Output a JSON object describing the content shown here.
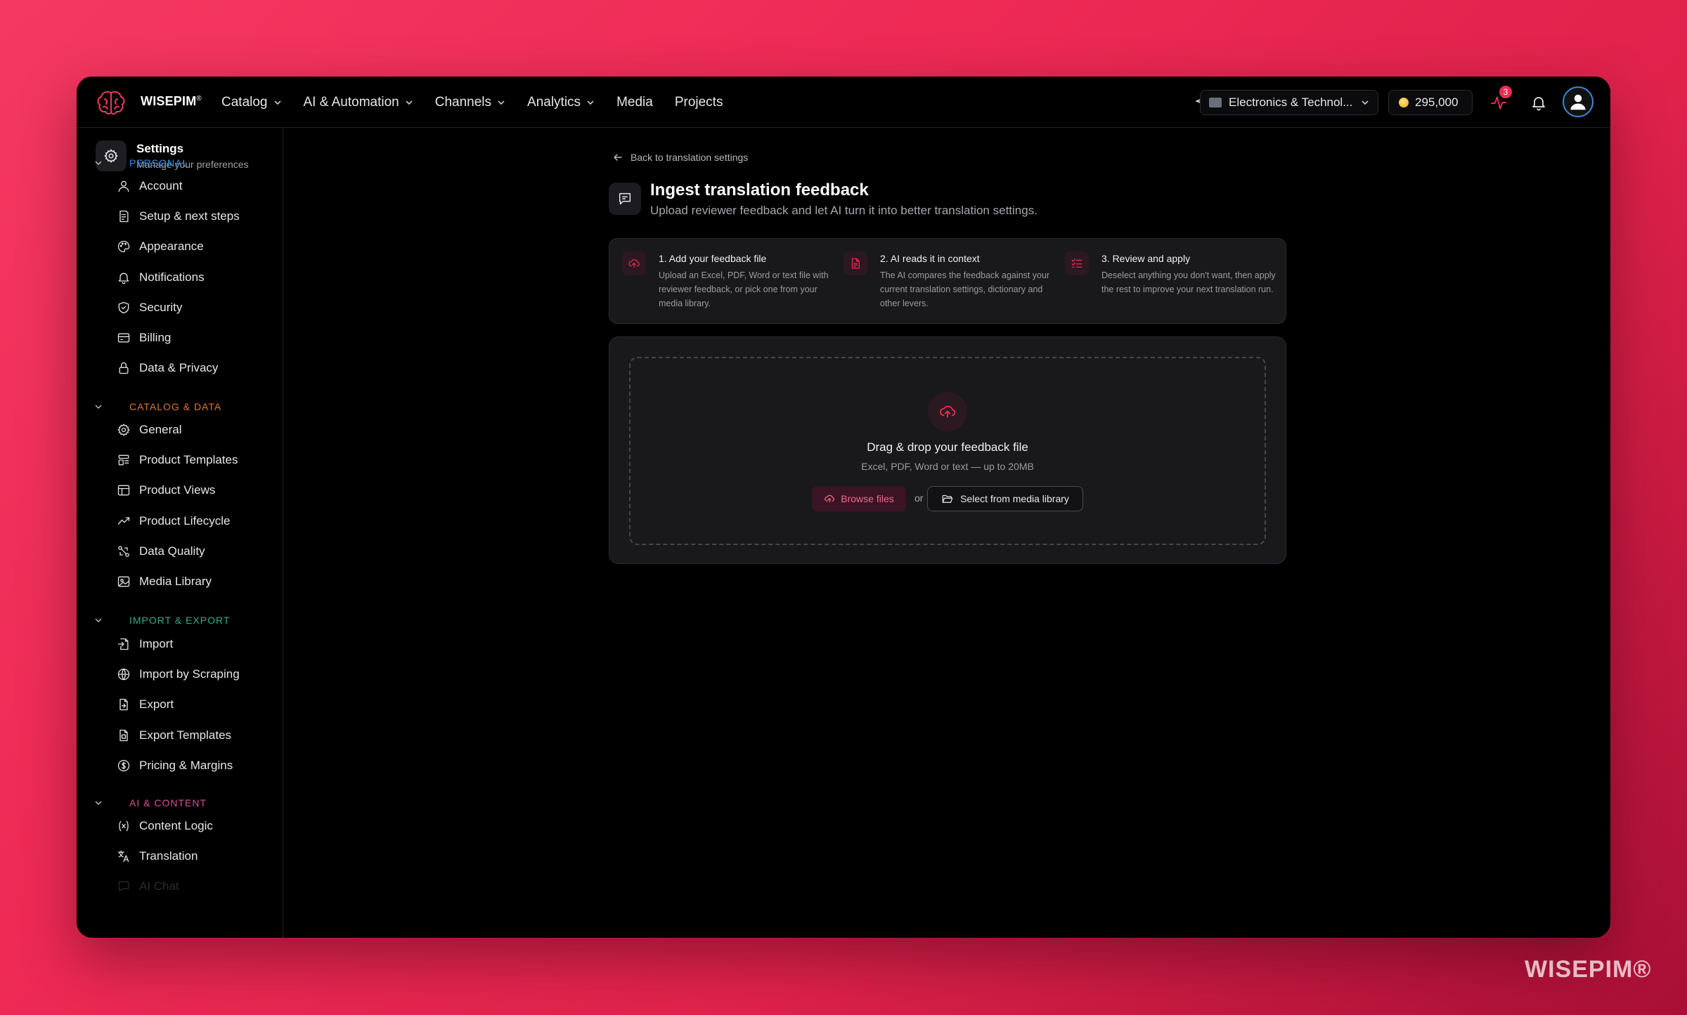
{
  "brand": {
    "name": "WISEPIM",
    "mark": "®"
  },
  "nav": [
    {
      "label": "Catalog",
      "has_menu": true
    },
    {
      "label": "AI & Automation",
      "has_menu": true
    },
    {
      "label": "Channels",
      "has_menu": true
    },
    {
      "label": "Analytics",
      "has_menu": true
    },
    {
      "label": "Media",
      "has_menu": false
    },
    {
      "label": "Projects",
      "has_menu": false
    }
  ],
  "topbar": {
    "workspace": "Electronics & Technol...",
    "credits": "295,000",
    "activity_badge": "3"
  },
  "sidebar": {
    "title": "Settings",
    "subtitle": "Manage your preferences",
    "sections": [
      {
        "label": "PERSONAL",
        "color": "#3d8ee0"
      },
      {
        "label": "CATALOG & DATA",
        "color": "#d9772e"
      },
      {
        "label": "IMPORT & EXPORT",
        "color": "#2fae88"
      },
      {
        "label": "AI & CONTENT",
        "color": "#d6509a"
      }
    ],
    "items": [
      {
        "label": "Account",
        "icon": "user-icon"
      },
      {
        "label": "Setup & next steps",
        "icon": "checklist-icon"
      },
      {
        "label": "Appearance",
        "icon": "palette-icon"
      },
      {
        "label": "Notifications",
        "icon": "bell-icon"
      },
      {
        "label": "Security",
        "icon": "shield-icon"
      },
      {
        "label": "Billing",
        "icon": "credit-card-icon"
      },
      {
        "label": "Data & Privacy",
        "icon": "lock-icon"
      },
      {
        "label": "General",
        "icon": "gear-icon"
      },
      {
        "label": "Product Templates",
        "icon": "template-icon"
      },
      {
        "label": "Product Views",
        "icon": "table-icon"
      },
      {
        "label": "Product Lifecycle",
        "icon": "trend-icon"
      },
      {
        "label": "Data Quality",
        "icon": "quality-icon"
      },
      {
        "label": "Media Library",
        "icon": "image-icon"
      },
      {
        "label": "Import",
        "icon": "file-import-icon"
      },
      {
        "label": "Import by Scraping",
        "icon": "globe-icon"
      },
      {
        "label": "Export",
        "icon": "file-export-icon"
      },
      {
        "label": "Export Templates",
        "icon": "file-template-icon"
      },
      {
        "label": "Pricing & Margins",
        "icon": "dollar-icon"
      },
      {
        "label": "Content Logic",
        "icon": "variable-icon"
      },
      {
        "label": "Translation",
        "icon": "translate-icon"
      },
      {
        "label": "AI Chat",
        "icon": "chat-icon"
      }
    ]
  },
  "main": {
    "back_link": "Back to translation settings",
    "title": "Ingest translation feedback",
    "subtitle": "Upload reviewer feedback and let AI turn it into better translation settings.",
    "steps": [
      {
        "title": "1. Add your feedback file",
        "desc": "Upload an Excel, PDF, Word or text file with reviewer feedback, or pick one from your media library.",
        "icon": "upload-cloud-icon"
      },
      {
        "title": "2. AI reads it in context",
        "desc": "The AI compares the feedback against your current translation settings, dictionary and other levers.",
        "icon": "document-icon"
      },
      {
        "title": "3. Review and apply",
        "desc": "Deselect anything you don't want, then apply the rest to improve your next translation run.",
        "icon": "list-check-icon"
      }
    ],
    "upload": {
      "title": "Drag & drop your feedback file",
      "hint": "Excel, PDF, Word or text — up to 20MB",
      "browse_label": "Browse files",
      "or_label": "or",
      "media_label": "Select from media library"
    }
  },
  "watermark": "WISEPIM®",
  "colors": {
    "accent": "#ee2a55",
    "background": "#000000"
  }
}
